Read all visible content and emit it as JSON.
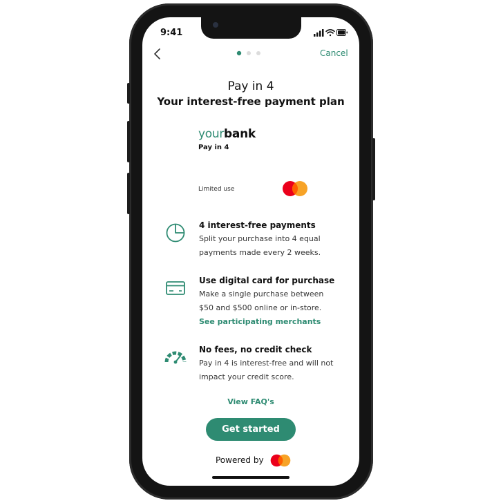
{
  "status_bar": {
    "time": "9:41"
  },
  "header": {
    "cancel_label": "Cancel",
    "step_current": 1,
    "step_total": 3
  },
  "title": {
    "line1": "Pay in 4",
    "line2": "Your interest-free payment plan"
  },
  "card": {
    "brand_part1": "your",
    "brand_part2": "bank",
    "product": "Pay in 4",
    "usage": "Limited use"
  },
  "features": [
    {
      "icon": "pie-chart-icon",
      "title": "4 interest-free payments",
      "desc": [
        "Split your purchase into 4 equal",
        "payments made every 2 weeks."
      ]
    },
    {
      "icon": "credit-card-icon",
      "title": "Use digital card for purchase",
      "desc": [
        "Make a single purchase between",
        "$50 and $500 online or in-store."
      ],
      "link": "See participating merchants"
    },
    {
      "icon": "gauge-icon",
      "title": "No fees, no credit check",
      "desc": [
        "Pay in 4 is interest-free and will not",
        "impact your credit score."
      ]
    }
  ],
  "faq_label": "View FAQ's",
  "cta_label": "Get started",
  "powered_by": "Powered by",
  "colors": {
    "accent": "#2e8b72",
    "mc_red": "#eb001b",
    "mc_orange": "#f79e1b"
  }
}
